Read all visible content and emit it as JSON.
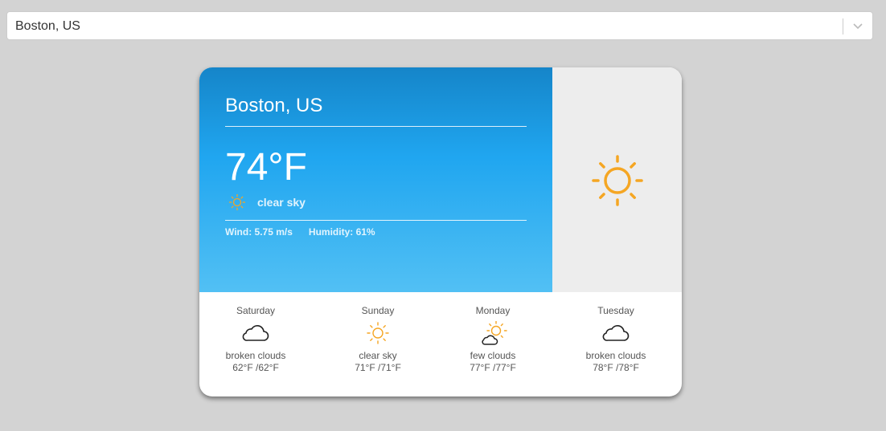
{
  "location_select": {
    "value": "Boston, US"
  },
  "current": {
    "city": "Boston, US",
    "temperature": "74°F",
    "condition": "clear sky",
    "condition_icon": "sun-icon",
    "wind": "Wind: 5.75 m/s",
    "humidity": "Humidity: 61%"
  },
  "forecast": [
    {
      "day": "Saturday",
      "icon": "cloud-icon",
      "description": "broken clouds",
      "temps": "62°F /62°F"
    },
    {
      "day": "Sunday",
      "icon": "sun-icon",
      "description": "clear sky",
      "temps": "71°F /71°F"
    },
    {
      "day": "Monday",
      "icon": "sun-cloud-icon",
      "description": "few clouds",
      "temps": "77°F /77°F"
    },
    {
      "day": "Tuesday",
      "icon": "cloud-icon",
      "description": "broken clouds",
      "temps": "78°F /78°F"
    }
  ],
  "colors": {
    "sun": "#f5a623",
    "panel_top": "#1585c9",
    "panel_bottom": "#52c0f4"
  }
}
